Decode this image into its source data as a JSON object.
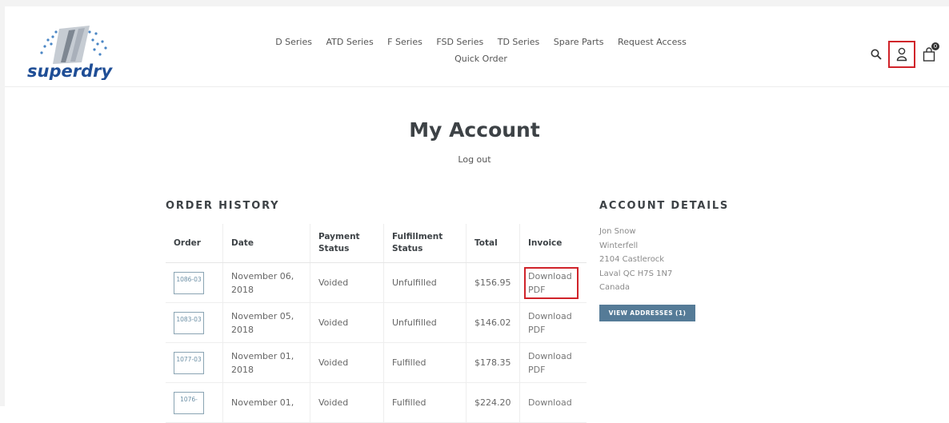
{
  "brand": {
    "logo_text": "superdry"
  },
  "nav": {
    "row1": [
      "D Series",
      "ATD Series",
      "F Series",
      "FSD Series",
      "TD Series",
      "Spare Parts",
      "Request Access"
    ],
    "row2": [
      "Quick Order"
    ]
  },
  "header_icons": {
    "search": "search-icon",
    "account": "account-icon",
    "cart": "cart-icon",
    "cart_count": "0",
    "highlight_color": "#d0232a"
  },
  "page": {
    "title": "My Account",
    "logout": "Log out"
  },
  "order_history": {
    "title": "ORDER HISTORY",
    "columns": [
      "Order",
      "Date",
      "Payment Status",
      "Fulfillment Status",
      "Total",
      "Invoice"
    ],
    "rows": [
      {
        "order": "1086-03",
        "date": "November 06, 2018",
        "payment": "Voided",
        "fulfillment": "Unfulfilled",
        "total": "$156.95",
        "invoice": "Download PDF"
      },
      {
        "order": "1083-03",
        "date": "November 05, 2018",
        "payment": "Voided",
        "fulfillment": "Unfulfilled",
        "total": "$146.02",
        "invoice": "Download PDF"
      },
      {
        "order": "1077-03",
        "date": "November 01, 2018",
        "payment": "Voided",
        "fulfillment": "Fulfilled",
        "total": "$178.35",
        "invoice": "Download PDF"
      },
      {
        "order": "1076-",
        "date": "November 01,",
        "payment": "Voided",
        "fulfillment": "Fulfilled",
        "total": "$224.20",
        "invoice": "Download"
      }
    ]
  },
  "account_details": {
    "title": "ACCOUNT DETAILS",
    "lines": [
      "Jon Snow",
      "Winterfell",
      "2104 Castlerock",
      "Laval QC H7S 1N7",
      "Canada"
    ],
    "button": "VIEW ADDRESSES (1)",
    "button_color": "#557b97"
  }
}
